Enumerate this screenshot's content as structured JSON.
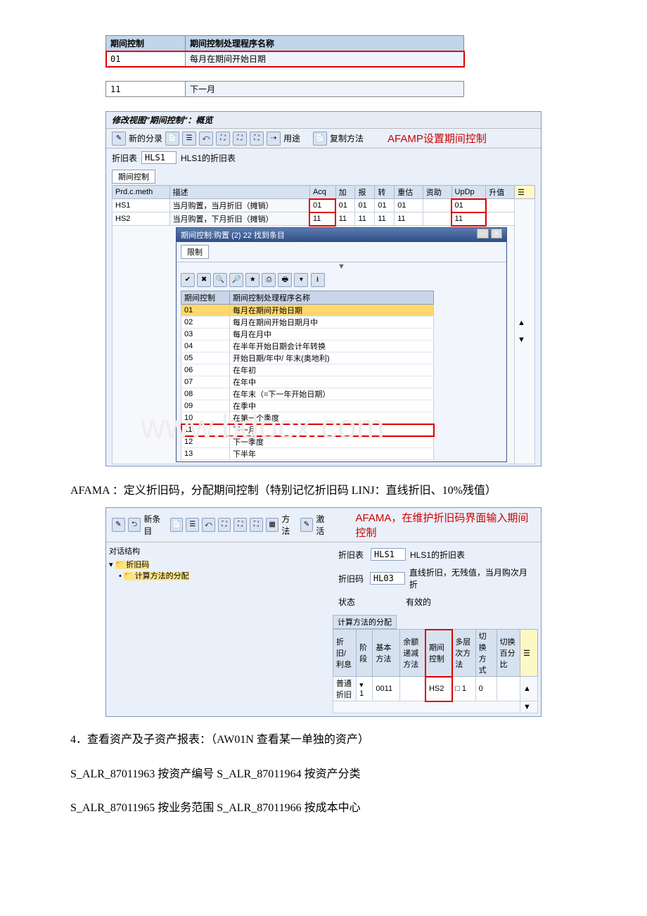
{
  "top_table": {
    "headers": [
      "期间控制",
      "期间控制处理程序名称"
    ],
    "row1": [
      "01",
      "每月在期间开始日期"
    ],
    "row2": [
      "11",
      "下一月"
    ]
  },
  "modify_view": {
    "title": "修改视图\"期间控制\"：概览",
    "toolbar": {
      "new_entries": "新的分录",
      "usage": "用途",
      "copy_method": "复制方法"
    },
    "annotation": "AFAMP设置期间控制",
    "depr_chart_label": "折旧表",
    "depr_chart_code": "HLS1",
    "depr_chart_desc": "HLS1的折旧表",
    "section_title": "期间控制",
    "grid_headers": [
      "Prd.c.meth",
      "描述",
      "Acq",
      "加",
      "报",
      "转",
      "重估",
      "资助",
      "UpDp",
      "升值"
    ],
    "grid_rows": [
      {
        "code": "HS1",
        "desc": "当月购置，当月折旧（摊销）",
        "vals": [
          "01",
          "01",
          "01",
          "01",
          "01",
          "",
          "01",
          ""
        ]
      },
      {
        "code": "HS2",
        "desc": "当月购置，下月折旧（摊销）",
        "vals": [
          "11",
          "11",
          "11",
          "11",
          "11",
          "",
          "11",
          ""
        ]
      }
    ]
  },
  "popup": {
    "title": "期间控制:购置 (2)   22 找到条目",
    "tab": "限制",
    "list_headers": [
      "期间控制",
      "期间控制处理程序名称"
    ],
    "rows": [
      [
        "01",
        "每月在期间开始日期"
      ],
      [
        "02",
        "每月在期间开始日期月中"
      ],
      [
        "03",
        "每月在月中"
      ],
      [
        "04",
        "在半年开始日期会计年转换"
      ],
      [
        "05",
        "开始日期/年中/ 年末(奥地利)"
      ],
      [
        "06",
        "在年初"
      ],
      [
        "07",
        "在年中"
      ],
      [
        "08",
        "在年末（=下一年开始日期）"
      ],
      [
        "09",
        "在季中"
      ],
      [
        "10",
        "在第一个季度"
      ],
      [
        "11",
        "下一月"
      ],
      [
        "12",
        "下一季度"
      ],
      [
        "13",
        "下半年"
      ]
    ],
    "highlight": 0,
    "redbox": 10
  },
  "paragraph1": "AFAMA ：定义折旧码，分配期间控制（特别记忆折旧码 LINJ：直线折旧、10%残值）",
  "afama": {
    "toolbar": {
      "new_entry": "新条目",
      "method": "方法",
      "activate": "激活"
    },
    "annotation": "AFAMA，在维护折旧码界面输入期间控制",
    "tree_header": "对话结构",
    "tree": [
      "折旧码",
      "计算方法的分配"
    ],
    "chart_label": "折旧表",
    "chart_code": "HLS1",
    "chart_desc": "HLS1的折旧表",
    "depkey_label": "折旧码",
    "depkey_code": "HL03",
    "depkey_desc": "直线折旧，无残值，当月购次月折",
    "status_label": "状态",
    "status_value": "有效的",
    "section_title": "计算方法的分配",
    "grid2_headers": [
      "折旧/利息",
      "阶段",
      "基本方法",
      "余额递减方法",
      "期间控制",
      "多层次方法",
      "切换方式",
      "切换百分比"
    ],
    "grid2_row": [
      "普通折旧",
      "1",
      "0011",
      "",
      "HS2",
      "1",
      "0",
      ""
    ]
  },
  "list_items": [
    "4．查看资产及子资产报表：（AW01N 查看某一单独的资产）",
    "S_ALR_87011963 按资产编号 S_ALR_87011964 按资产分类",
    "S_ALR_87011965 按业务范围 S_ALR_87011966 按成本中心"
  ],
  "watermark": "www.bdocx.com"
}
